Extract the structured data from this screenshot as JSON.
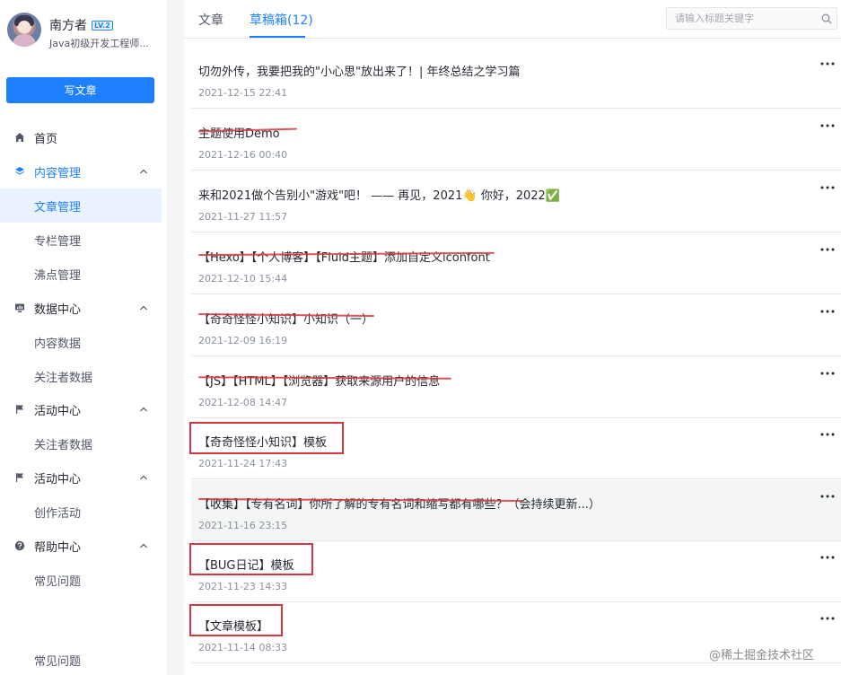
{
  "profile": {
    "name": "南方者",
    "level": "LV.2",
    "title": "Java初级开发工程师..."
  },
  "sidebar": {
    "write_button": "写文章",
    "items": [
      {
        "label": "首页",
        "icon": "home-icon"
      },
      {
        "label": "内容管理",
        "icon": "layers-icon",
        "expanded": true
      },
      {
        "label": "文章管理",
        "sub": true,
        "active": true
      },
      {
        "label": "专栏管理",
        "sub": true
      },
      {
        "label": "沸点管理",
        "sub": true
      },
      {
        "label": "数据中心",
        "icon": "chart-icon",
        "expanded": true
      },
      {
        "label": "内容数据",
        "sub": true
      },
      {
        "label": "关注者数据",
        "sub": true
      },
      {
        "label": "活动中心",
        "icon": "flag-icon",
        "expanded": true
      },
      {
        "label": "关注者数据",
        "sub": true
      },
      {
        "label": "活动中心",
        "icon": "flag-icon",
        "expanded": true
      },
      {
        "label": "创作活动",
        "sub": true
      },
      {
        "label": "帮助中心",
        "icon": "help-icon",
        "expanded": true
      },
      {
        "label": "常见问题",
        "sub": true
      }
    ],
    "bottom_item": "常见问题"
  },
  "tabs": [
    {
      "label": "文章",
      "active": false
    },
    {
      "label": "草稿箱(12)",
      "active": true
    }
  ],
  "search": {
    "placeholder": "请输入标题关键字",
    "icon": "search-icon"
  },
  "articles": [
    {
      "title": "切勿外传，我要把我的\"小心思\"放出来了！| 年终总结之学习篇",
      "date": "2021-12-15 22:41",
      "struck": false,
      "boxed": false
    },
    {
      "title": "主题使用Demo",
      "date": "2021-12-16 00:40",
      "struck": true,
      "boxed": false
    },
    {
      "title": "来和2021做个告别小\"游戏\"吧！ —— 再见，2021👋 你好，2022✅",
      "date": "2021-11-27 11:57",
      "struck": false,
      "boxed": false
    },
    {
      "title": "【Hexo】【个人博客】【Fluid主题】添加自定义iconfont",
      "date": "2021-12-10 15:44",
      "struck": true,
      "boxed": false
    },
    {
      "title": "【奇奇怪怪小知识】小知识（一）",
      "date": "2021-12-09 16:19",
      "struck": true,
      "boxed": false
    },
    {
      "title": "【JS】【HTML】【浏览器】获取来源用户的信息",
      "date": "2021-12-08 14:47",
      "struck": true,
      "boxed": false
    },
    {
      "title": "【奇奇怪怪小知识】模板",
      "date": "2021-11-24 17:43",
      "struck": false,
      "boxed": true
    },
    {
      "title": "【收集】【专有名词】你所了解的专有名词和缩写都有哪些？（会持续更新...）",
      "date": "2021-11-16 23:15",
      "struck": true,
      "boxed": false
    },
    {
      "title": "【BUG日记】模板",
      "date": "2021-11-23 14:33",
      "struck": false,
      "boxed": true
    },
    {
      "title": "【文章模板】",
      "date": "2021-11-14 08:33",
      "struck": false,
      "boxed": true
    }
  ],
  "watermark": "@稀土掘金技术社区",
  "colors": {
    "accent": "#1e80ff",
    "annotation_red": "#d9363e"
  }
}
